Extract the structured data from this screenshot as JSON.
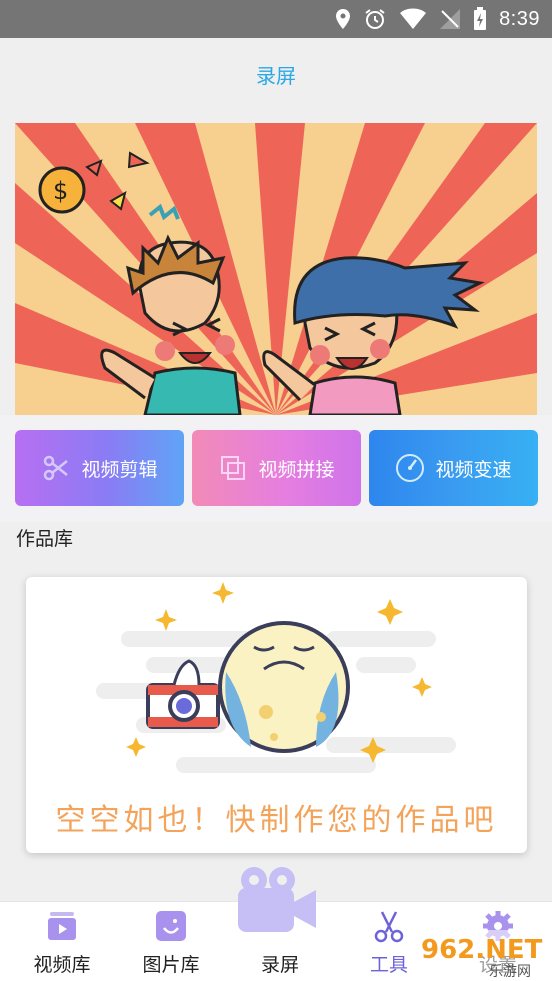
{
  "status_bar": {
    "time": "8:39",
    "icons": [
      "location-icon",
      "alarm-icon",
      "wifi-icon",
      "signal-off-icon",
      "battery-charging-icon"
    ]
  },
  "header": {
    "title": "录屏"
  },
  "tools": [
    {
      "label": "视频剪辑",
      "icon": "scissors-icon"
    },
    {
      "label": "视频拼接",
      "icon": "merge-icon"
    },
    {
      "label": "视频变速",
      "icon": "speedometer-icon"
    }
  ],
  "works": {
    "title": "作品库",
    "empty_text": "空空如也！快制作您的作品吧"
  },
  "bottom_nav": {
    "items": [
      {
        "label": "视频库",
        "icon": "video-library-icon"
      },
      {
        "label": "图片库",
        "icon": "image-library-icon"
      },
      {
        "label": "录屏",
        "icon": "camera-icon"
      },
      {
        "label": "工具",
        "icon": "scissors-icon"
      },
      {
        "label": "设置",
        "icon": "gear-icon"
      }
    ],
    "active": "工具"
  },
  "watermark": {
    "text": "962.NET",
    "subtext": "乐游网"
  },
  "colors": {
    "title_blue": "#2aa7e6",
    "active_purple": "#6e62d9",
    "empty_text_orange": "#f3a35a",
    "status_bar_gray": "#757575"
  }
}
